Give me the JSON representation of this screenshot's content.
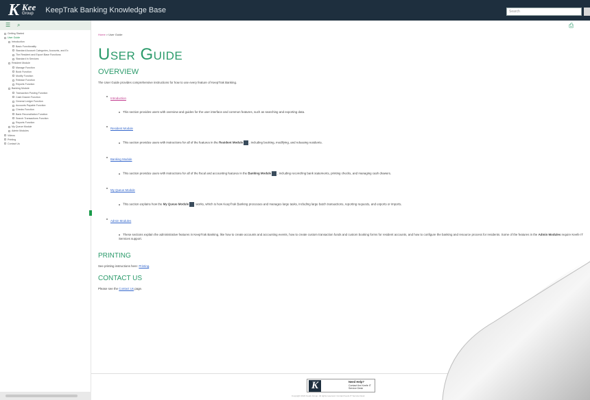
{
  "header": {
    "logo_k": "K",
    "logo_name": "Kee",
    "logo_sub": "Group",
    "title": "KeepTrak Banking Knowledge Base",
    "search_placeholder": "Search"
  },
  "sidebar": {
    "items": [
      "Getting Started",
      "User Guide",
      "Introduction",
      "Basic Functionality",
      "Standard Account Categories, Accounts, and Ex",
      "The Resident and Export Base Functions",
      "Standard In Services",
      "Resident Module",
      "Manage Function",
      "Book Function",
      "Modify Function",
      "Release Function",
      "Reports Function",
      "Banking Module",
      "Transaction Posting Function",
      "Cash Drawer Function",
      "General Ledger Function",
      "Accounts Payable Function",
      "Checks Function",
      "Bank Reconciliation Function",
      "Search Transactions Function",
      "Reports Function",
      "My Queue Module",
      "Admin Modules",
      "Videos",
      "Printing",
      "Contact Us"
    ]
  },
  "breadcrumb": {
    "home": "Home",
    "current": "User Guide"
  },
  "main": {
    "title": "User Guide",
    "overview_heading": "OVERVIEW",
    "intro": "The User Guide provides comprehensive instructions for how to use every feature of KeepTrak Banking.",
    "sections": [
      {
        "link": "Introduction",
        "desc": "This section provides users with overview and guides for the user interface and common features, such as searching and exporting data."
      },
      {
        "link": "Resident Module",
        "desc_pre": "This section provides users with instructions for all of the features in the ",
        "bold": "Resident Module",
        "desc_post": ", including booking, modifying, and releasing residents."
      },
      {
        "link": "Banking Module",
        "desc_pre": "This section provides users with instructions for all of the fiscal and accounting features in the ",
        "bold": "Banking Module",
        "desc_post": ", including reconciling bank statements, printing checks, and managing cash drawers."
      },
      {
        "link": "My Queue Module",
        "desc_pre": "This section explains how the ",
        "bold": "My Queue Module",
        "desc_post": " works, which is how KeepTrak Banking processes and manages large tasks, including large batch transactions, reporting requests, and exports or imports."
      },
      {
        "link": "Admin Modules",
        "desc_pre": "These sections explain the administrative features in KeepTrak Banking, like how to create accounts and accounting events, how to create custom transaction funds and custom booking forms for resident accounts, and how to configure the banking and resource process for residents. Some of the features in the ",
        "bold": "Admin Modules",
        "desc_post": " require Keefe IT Services support."
      }
    ],
    "printing_heading": "PRINTING",
    "printing_text": "See printing instructions here: ",
    "printing_link": "Printing",
    "contact_heading": "CONTACT US",
    "contact_pre": "Please see the ",
    "contact_link": "Contact Us",
    "contact_post": " page."
  },
  "footer": {
    "k": "K",
    "need_help": "Need Help?",
    "help_sub": "Contact the Keefe IT Service Desk",
    "copyright": "Copyright 2022 Keefe Group. All rights reserved. Contact Keefe IT Service Desk"
  }
}
